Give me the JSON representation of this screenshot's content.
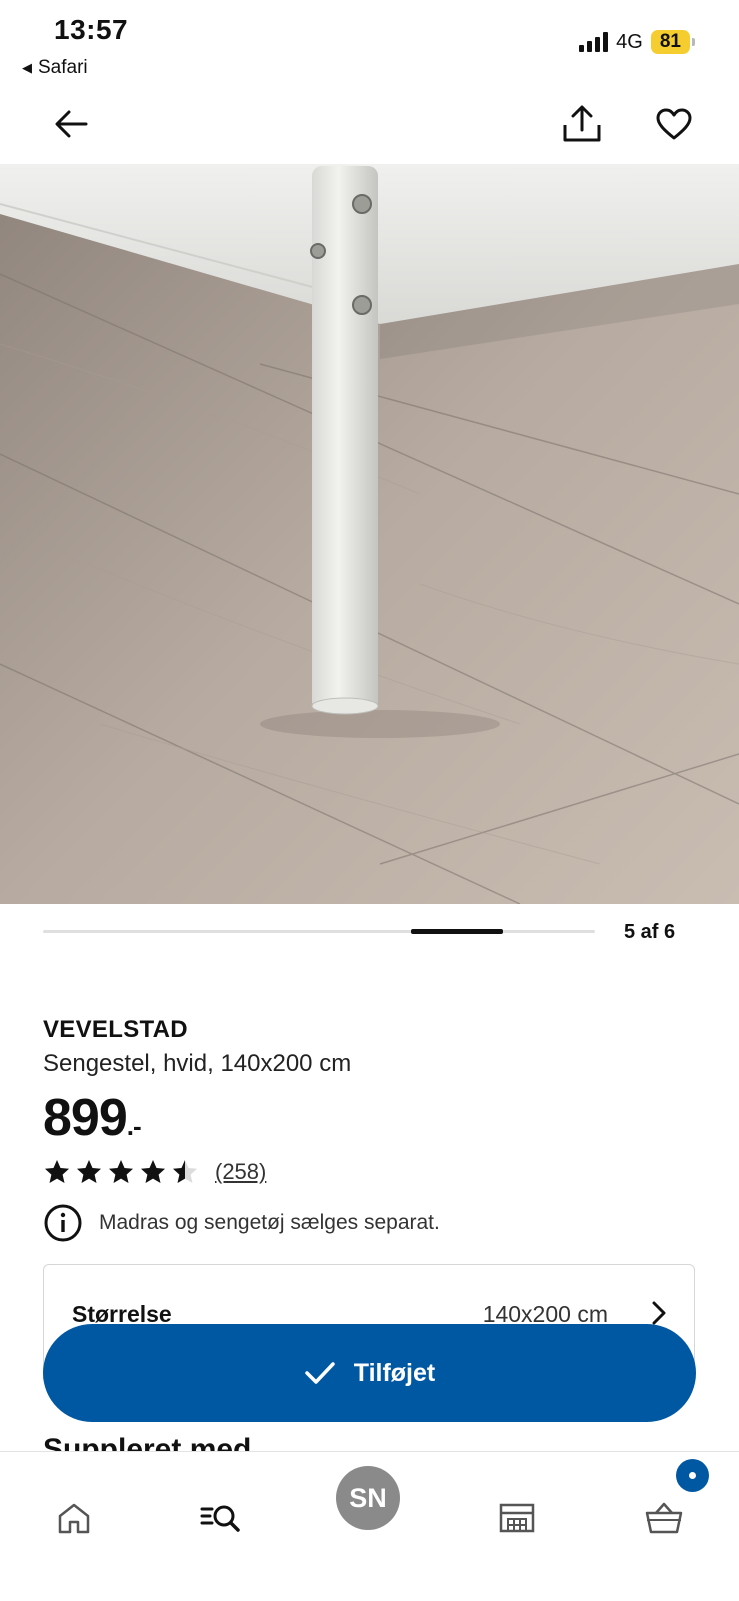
{
  "status_bar": {
    "time": "13:57",
    "back_app": "Safari",
    "network": "4G",
    "battery": "81",
    "battery_color": "#f5cd2f"
  },
  "nav": {
    "back_icon": "arrow-left-icon",
    "share_icon": "share-icon",
    "favorite_icon": "heart-icon"
  },
  "gallery": {
    "counter": "5 af 6",
    "current": 5,
    "total": 6
  },
  "product": {
    "name": "VEVELSTAD",
    "description": "Sengestel, hvid, 140x200 cm",
    "price": "899",
    "price_suffix": ".-",
    "rating": 4.5,
    "rating_max": 5,
    "review_count": "(258)",
    "notice": "Madras og sengetøj sælges separat."
  },
  "size_selector": {
    "label": "Størrelse",
    "value": "140x200 cm"
  },
  "added_button": {
    "label": "Tilføjet",
    "color": "#0058a3"
  },
  "section": {
    "supplement_heading": "Suppleret med"
  },
  "tabbar": {
    "avatar_initials": "SN",
    "items": [
      "home-icon",
      "search-icon",
      "avatar",
      "store-icon",
      "cart-icon"
    ],
    "accent": "#0058a3"
  }
}
